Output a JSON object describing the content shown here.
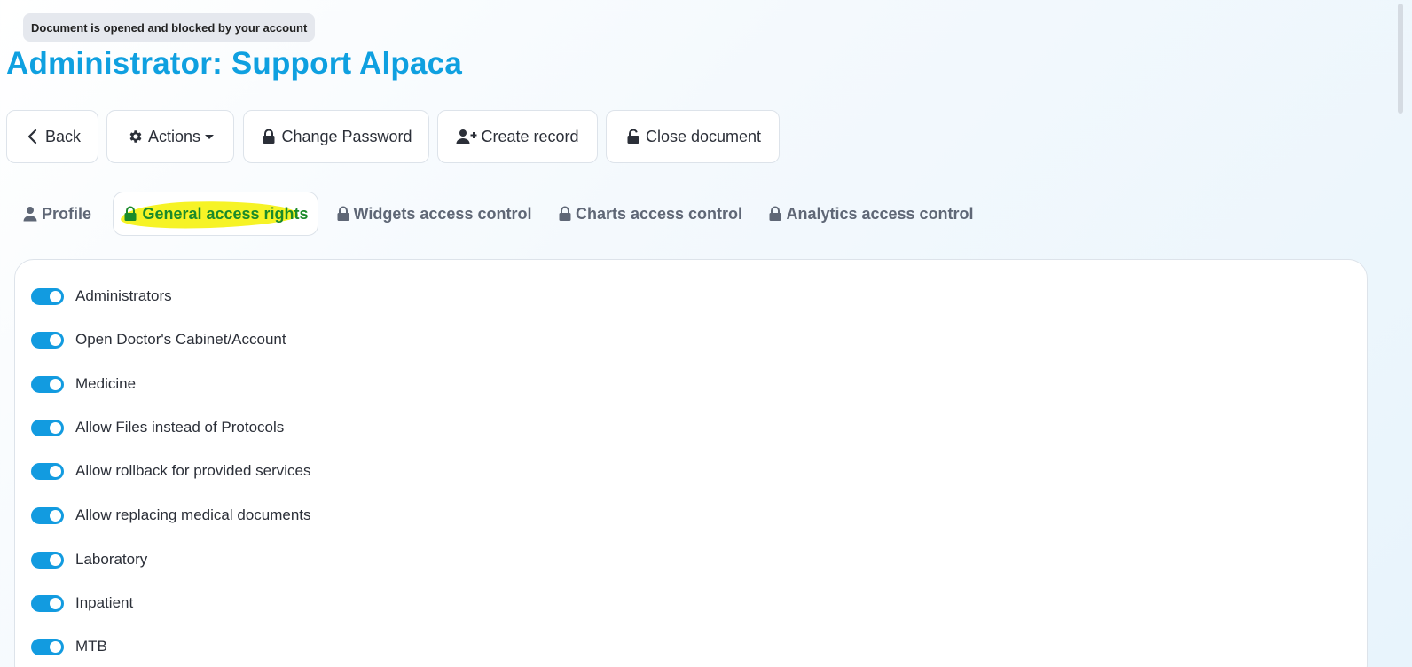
{
  "status": {
    "text": "Document is opened and blocked by your account"
  },
  "header": {
    "title": "Administrator: Support Alpaca"
  },
  "toolbar": {
    "back_label": "Back",
    "actions_label": "Actions",
    "change_password_label": "Change Password",
    "create_record_label": "Create record",
    "close_document_label": "Close document"
  },
  "tabs": [
    {
      "label": "Profile",
      "icon": "user-icon",
      "active": false
    },
    {
      "label": "General access rights",
      "icon": "lock-icon",
      "active": true
    },
    {
      "label": "Widgets access control",
      "icon": "lock-icon",
      "active": false
    },
    {
      "label": "Charts access control",
      "icon": "lock-icon",
      "active": false
    },
    {
      "label": "Analytics access control",
      "icon": "lock-icon",
      "active": false
    }
  ],
  "permissions": [
    {
      "label": "Administrators",
      "enabled": true
    },
    {
      "label": "Open Doctor's Cabinet/Account",
      "enabled": true
    },
    {
      "label": "Medicine",
      "enabled": true
    },
    {
      "label": "Allow Files instead of Protocols",
      "enabled": true
    },
    {
      "label": "Allow rollback for provided services",
      "enabled": true
    },
    {
      "label": "Allow replacing medical documents",
      "enabled": true
    },
    {
      "label": "Laboratory",
      "enabled": true
    },
    {
      "label": "Inpatient",
      "enabled": true
    },
    {
      "label": "MTB",
      "enabled": true
    }
  ],
  "colors": {
    "accent": "#0fa0e0",
    "toggle_on": "#129be0",
    "active_tab_text": "#1a8a2a",
    "highlight": "#f5f21a"
  }
}
